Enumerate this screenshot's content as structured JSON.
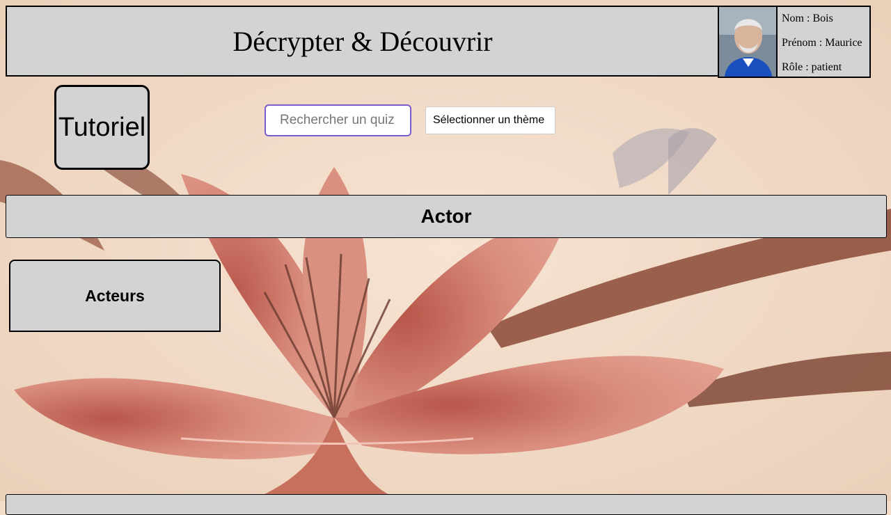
{
  "header": {
    "title": "Décrypter & Découvrir"
  },
  "profile": {
    "avatar_icon": "user-photo",
    "nom": "Nom : Bois",
    "prenom": "Prénom : Maurice",
    "role": "Rôle : patient"
  },
  "toolbar": {
    "tutorial_label": "Tutoriel",
    "search_placeholder": "Rechercher un quiz",
    "theme_select_label": "Sélectionner un thème"
  },
  "section": {
    "title": "Actor"
  },
  "quizzes": [
    {
      "label": "Acteurs"
    }
  ],
  "colors": {
    "panel": "#d3d3d3",
    "border": "#000000",
    "search_focus": "#7a5cd0",
    "background": "#f3dcc8"
  }
}
